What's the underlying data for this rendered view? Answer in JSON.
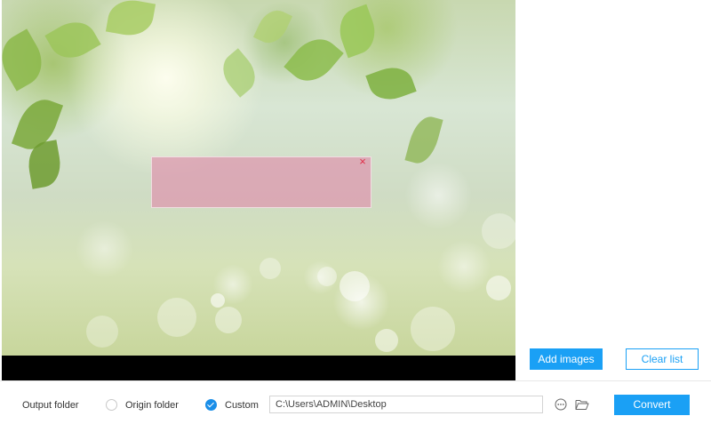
{
  "preview": {
    "watermark_close_glyph": "×"
  },
  "list_actions": {
    "add_images_label": "Add images",
    "clear_list_label": "Clear list"
  },
  "output": {
    "folder_label": "Output folder",
    "origin_folder_label": "Origin folder",
    "custom_label": "Custom",
    "selected_option": "Custom",
    "custom_path": "C:\\Users\\ADMIN\\Desktop",
    "convert_label": "Convert"
  },
  "icons": {
    "more_options": "ellipsis-circle-icon",
    "browse_folder": "folder-open-icon"
  },
  "colors": {
    "accent": "#1aa0f5",
    "watermark_overlay": "#de96af",
    "close_red": "#e0304a"
  }
}
